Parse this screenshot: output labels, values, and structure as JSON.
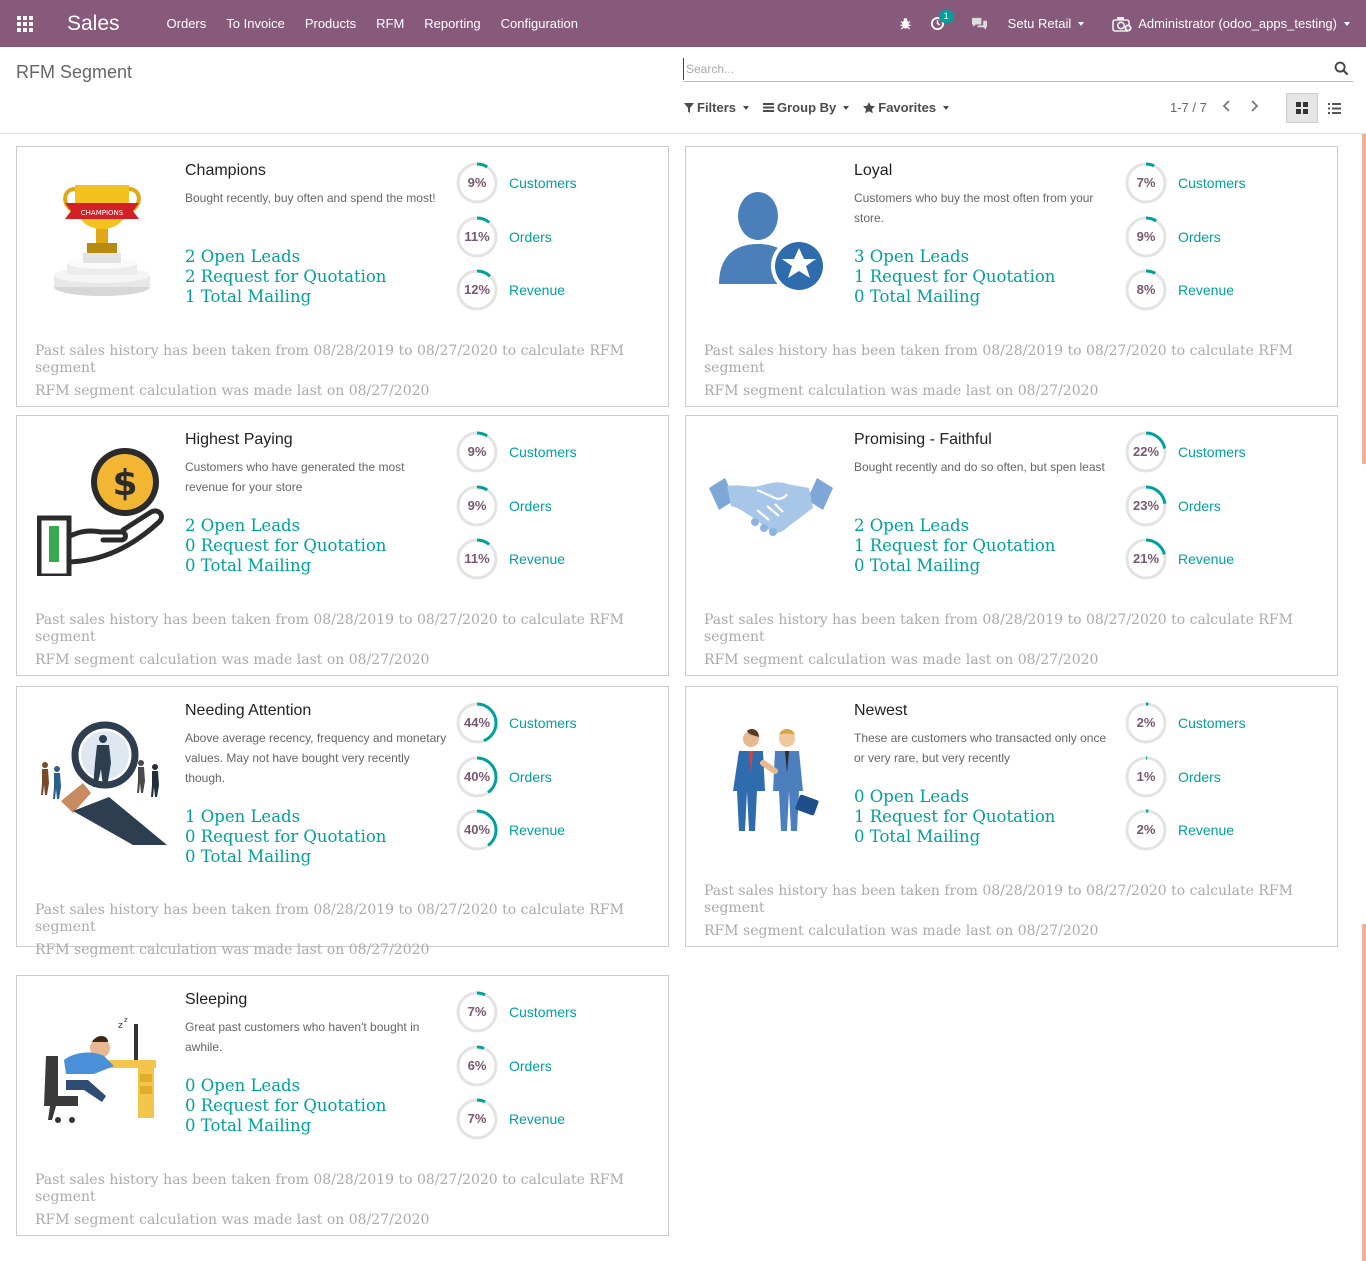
{
  "app": {
    "brand": "Sales",
    "menu": [
      "Orders",
      "To Invoice",
      "Products",
      "RFM",
      "Reporting",
      "Configuration"
    ]
  },
  "navbar": {
    "activity_count": "1",
    "company": "Setu Retail",
    "user": "Administrator (odoo_apps_testing)"
  },
  "control": {
    "title": "RFM Segment",
    "search_placeholder": "Search...",
    "filters": "Filters",
    "group_by": "Group By",
    "favorites": "Favorites",
    "pager": "1-7 / 7"
  },
  "colors": {
    "navbar": "#875a7b",
    "teal": "#00a09d",
    "donut_text": "#7a5772",
    "accent": "#f3ae8f"
  },
  "segments": [
    {
      "title": "Champions",
      "icon": "trophy-icon",
      "description": "Bought recently, buy often and spend the most!",
      "links": [
        "2 Open Leads",
        "2 Request for Quotation",
        "1 Total Mailing"
      ],
      "stats": [
        {
          "pct": 9,
          "label": "Customers"
        },
        {
          "pct": 11,
          "label": "Orders"
        },
        {
          "pct": 12,
          "label": "Revenue"
        }
      ],
      "history": "Past sales history has been taken from 08/28/2019 to 08/27/2020 to calculate RFM segment",
      "calc": "RFM segment calculation was made last on 08/27/2020"
    },
    {
      "title": "Loyal",
      "icon": "loyal-user-star-icon",
      "description": "Customers who buy the most often from your store.",
      "links": [
        "3 Open Leads",
        "1 Request for Quotation",
        "0 Total Mailing"
      ],
      "stats": [
        {
          "pct": 7,
          "label": "Customers"
        },
        {
          "pct": 9,
          "label": "Orders"
        },
        {
          "pct": 8,
          "label": "Revenue"
        }
      ],
      "history": "Past sales history has been taken from 08/28/2019 to 08/27/2020 to calculate RFM segment",
      "calc": "RFM segment calculation was made last on 08/27/2020"
    },
    {
      "title": "Highest Paying",
      "icon": "hand-coin-icon",
      "description": "Customers who have generated the most revenue for your store",
      "links": [
        "2 Open Leads",
        "0 Request for Quotation",
        "0 Total Mailing"
      ],
      "stats": [
        {
          "pct": 9,
          "label": "Customers"
        },
        {
          "pct": 9,
          "label": "Orders"
        },
        {
          "pct": 11,
          "label": "Revenue"
        }
      ],
      "history": "Past sales history has been taken from 08/28/2019 to 08/27/2020 to calculate RFM segment",
      "calc": "RFM segment calculation was made last on 08/27/2020"
    },
    {
      "title": "Promising - Faithful",
      "icon": "handshake-icon",
      "description": "Bought recently and do so often, but spen least",
      "links": [
        "2 Open Leads",
        "1 Request for Quotation",
        "0 Total Mailing"
      ],
      "stats": [
        {
          "pct": 22,
          "label": "Customers"
        },
        {
          "pct": 23,
          "label": "Orders"
        },
        {
          "pct": 21,
          "label": "Revenue"
        }
      ],
      "history": "Past sales history has been taken from 08/28/2019 to 08/27/2020 to calculate RFM segment",
      "calc": "RFM segment calculation was made last on 08/27/2020"
    },
    {
      "title": "Needing Attention",
      "icon": "magnifier-people-icon",
      "description": "Above average recency, frequency and monetary values. May not have bought very recently though.",
      "links": [
        "1 Open Leads",
        "0 Request for Quotation",
        "0 Total Mailing"
      ],
      "stats": [
        {
          "pct": 44,
          "label": "Customers"
        },
        {
          "pct": 40,
          "label": "Orders"
        },
        {
          "pct": 40,
          "label": "Revenue"
        }
      ],
      "history": "Past sales history has been taken from 08/28/2019 to 08/27/2020 to calculate RFM segment",
      "calc": "RFM segment calculation was made last on 08/27/2020"
    },
    {
      "title": "Newest",
      "icon": "businessmen-handshake-icon",
      "description": "These are customers who transacted only once or very rare, but very recently",
      "links": [
        "0 Open Leads",
        "1 Request for Quotation",
        "0 Total Mailing"
      ],
      "stats": [
        {
          "pct": 2,
          "label": "Customers"
        },
        {
          "pct": 1,
          "label": "Orders"
        },
        {
          "pct": 2,
          "label": "Revenue"
        }
      ],
      "history": "Past sales history has been taken from 08/28/2019 to 08/27/2020 to calculate RFM segment",
      "calc": "RFM segment calculation was made last on 08/27/2020"
    },
    {
      "title": "Sleeping",
      "icon": "sleeping-worker-icon",
      "description": "Great past customers who haven't bought in awhile.",
      "links": [
        "0 Open Leads",
        "0 Request for Quotation",
        "0 Total Mailing"
      ],
      "stats": [
        {
          "pct": 7,
          "label": "Customers"
        },
        {
          "pct": 6,
          "label": "Orders"
        },
        {
          "pct": 7,
          "label": "Revenue"
        }
      ],
      "history": "Past sales history has been taken from 08/28/2019 to 08/27/2020 to calculate RFM segment",
      "calc": "RFM segment calculation was made last on 08/27/2020"
    }
  ]
}
